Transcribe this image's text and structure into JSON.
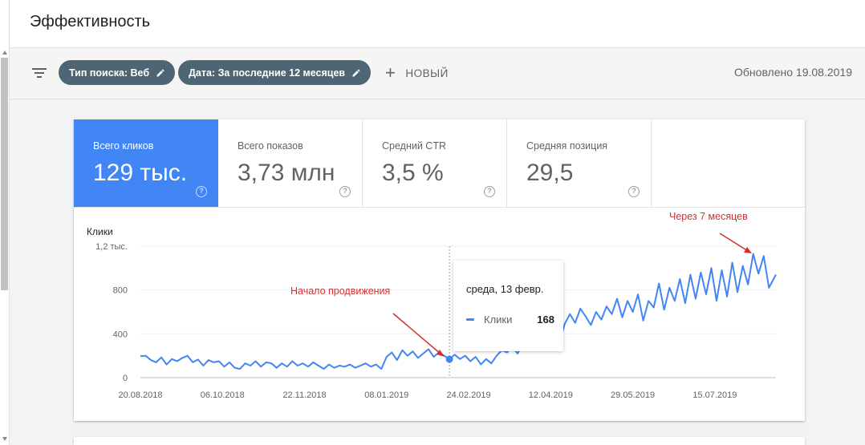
{
  "header": {
    "title": "Эффективность"
  },
  "filters": {
    "chips": [
      {
        "label": "Тип поиска: Веб"
      },
      {
        "label": "Дата: За последние 12 месяцев"
      }
    ],
    "new_label": "НОВЫЙ",
    "updated": "Обновлено 19.08.2019"
  },
  "metrics": [
    {
      "label": "Всего кликов",
      "value": "129 тыс.",
      "active": true
    },
    {
      "label": "Всего показов",
      "value": "3,73 млн",
      "active": false
    },
    {
      "label": "Средний CTR",
      "value": "3,5 %",
      "active": false
    },
    {
      "label": "Средняя позиция",
      "value": "29,5",
      "active": false
    }
  ],
  "help_glyph": "?",
  "tooltip": {
    "date": "среда, 13 февр.",
    "series": "Клики",
    "value": "168"
  },
  "annotations": {
    "start": "Начало продвижения",
    "after": "Через 7 месяцев"
  },
  "colors": {
    "accent": "#4285f4",
    "chip": "#4e6673",
    "annotation": "#d32f2f"
  },
  "chart_data": {
    "type": "line",
    "ylabel": "Клики",
    "y_ticks": [
      "0",
      "400",
      "800",
      "1,2 тыс."
    ],
    "y_tick_values": [
      0,
      400,
      800,
      1200
    ],
    "ylim": [
      0,
      1200
    ],
    "x_ticks": [
      "20.08.2018",
      "06.10.2018",
      "22.11.2018",
      "08.01.2019",
      "24.02.2019",
      "12.04.2019",
      "29.05.2019",
      "15.07.2019"
    ],
    "x_tick_days": [
      0,
      47,
      94,
      141,
      188,
      235,
      282,
      329
    ],
    "x_range_days": [
      0,
      364
    ],
    "grid": true,
    "highlight_day": 177,
    "series": [
      {
        "name": "Клики",
        "points": [
          [
            0,
            195
          ],
          [
            3,
            200
          ],
          [
            6,
            160
          ],
          [
            9,
            140
          ],
          [
            12,
            185
          ],
          [
            15,
            120
          ],
          [
            18,
            170
          ],
          [
            21,
            150
          ],
          [
            24,
            180
          ],
          [
            27,
            200
          ],
          [
            30,
            140
          ],
          [
            33,
            165
          ],
          [
            36,
            110
          ],
          [
            39,
            160
          ],
          [
            42,
            140
          ],
          [
            45,
            150
          ],
          [
            48,
            100
          ],
          [
            51,
            140
          ],
          [
            54,
            90
          ],
          [
            57,
            80
          ],
          [
            60,
            130
          ],
          [
            63,
            110
          ],
          [
            66,
            150
          ],
          [
            69,
            100
          ],
          [
            72,
            140
          ],
          [
            75,
            130
          ],
          [
            78,
            90
          ],
          [
            81,
            130
          ],
          [
            84,
            100
          ],
          [
            87,
            150
          ],
          [
            90,
            110
          ],
          [
            93,
            130
          ],
          [
            96,
            100
          ],
          [
            99,
            140
          ],
          [
            102,
            110
          ],
          [
            105,
            80
          ],
          [
            108,
            120
          ],
          [
            111,
            90
          ],
          [
            114,
            110
          ],
          [
            117,
            100
          ],
          [
            120,
            120
          ],
          [
            123,
            90
          ],
          [
            126,
            110
          ],
          [
            129,
            130
          ],
          [
            132,
            100
          ],
          [
            135,
            120
          ],
          [
            138,
            80
          ],
          [
            141,
            190
          ],
          [
            144,
            230
          ],
          [
            147,
            160
          ],
          [
            150,
            250
          ],
          [
            153,
            200
          ],
          [
            156,
            240
          ],
          [
            159,
            180
          ],
          [
            162,
            220
          ],
          [
            165,
            260
          ],
          [
            168,
            190
          ],
          [
            171,
            230
          ],
          [
            174,
            200
          ],
          [
            177,
            168
          ],
          [
            180,
            210
          ],
          [
            183,
            170
          ],
          [
            186,
            200
          ],
          [
            189,
            150
          ],
          [
            192,
            190
          ],
          [
            195,
            120
          ],
          [
            198,
            170
          ],
          [
            201,
            130
          ],
          [
            204,
            200
          ],
          [
            207,
            250
          ],
          [
            210,
            230
          ],
          [
            213,
            280
          ],
          [
            216,
            220
          ],
          [
            219,
            300
          ],
          [
            222,
            260
          ],
          [
            225,
            350
          ],
          [
            228,
            290
          ],
          [
            231,
            380
          ],
          [
            234,
            330
          ],
          [
            237,
            440
          ],
          [
            240,
            300
          ],
          [
            243,
            490
          ],
          [
            246,
            580
          ],
          [
            249,
            500
          ],
          [
            252,
            630
          ],
          [
            255,
            560
          ],
          [
            258,
            480
          ],
          [
            261,
            600
          ],
          [
            264,
            530
          ],
          [
            267,
            650
          ],
          [
            270,
            580
          ],
          [
            273,
            720
          ],
          [
            276,
            550
          ],
          [
            279,
            700
          ],
          [
            282,
            600
          ],
          [
            285,
            760
          ],
          [
            288,
            520
          ],
          [
            291,
            700
          ],
          [
            294,
            640
          ],
          [
            297,
            860
          ],
          [
            300,
            620
          ],
          [
            303,
            820
          ],
          [
            306,
            700
          ],
          [
            309,
            900
          ],
          [
            312,
            680
          ],
          [
            315,
            940
          ],
          [
            318,
            720
          ],
          [
            321,
            960
          ],
          [
            324,
            760
          ],
          [
            327,
            1000
          ],
          [
            330,
            700
          ],
          [
            333,
            980
          ],
          [
            336,
            740
          ],
          [
            339,
            1050
          ],
          [
            342,
            780
          ],
          [
            345,
            1020
          ],
          [
            348,
            850
          ],
          [
            351,
            1130
          ],
          [
            354,
            950
          ],
          [
            357,
            1110
          ],
          [
            360,
            820
          ],
          [
            364,
            940
          ]
        ]
      }
    ]
  }
}
